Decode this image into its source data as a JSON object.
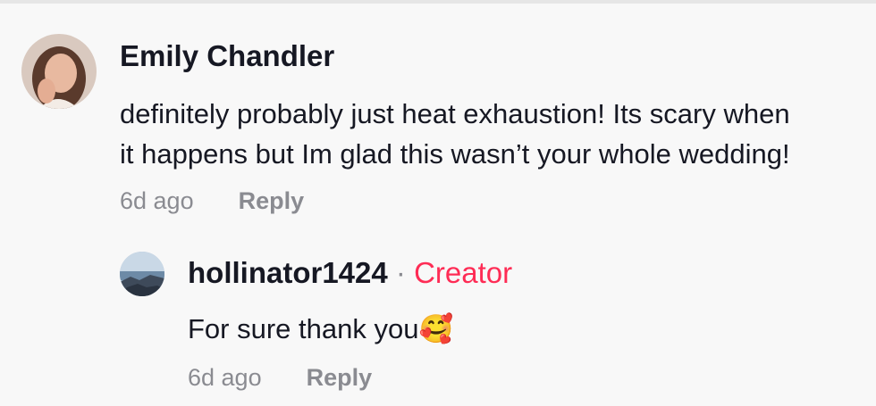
{
  "comment": {
    "username": "Emily Chandler",
    "text_line1": "definitely probably just heat exhaustion! Its scary when",
    "text_line2": "it happens but Im glad this wasn’t your whole wedding!",
    "time": "6d ago",
    "reply_label": "Reply"
  },
  "reply": {
    "username": "hollinator1424",
    "separator": "·",
    "badge": "Creator",
    "text": "For sure thank you",
    "emoji": "🥰",
    "time": "6d ago",
    "reply_label": "Reply"
  },
  "colors": {
    "creator_badge": "#fe2c55",
    "secondary_text": "#8a8b91",
    "primary_text": "#161823",
    "background": "#f8f8f8"
  }
}
